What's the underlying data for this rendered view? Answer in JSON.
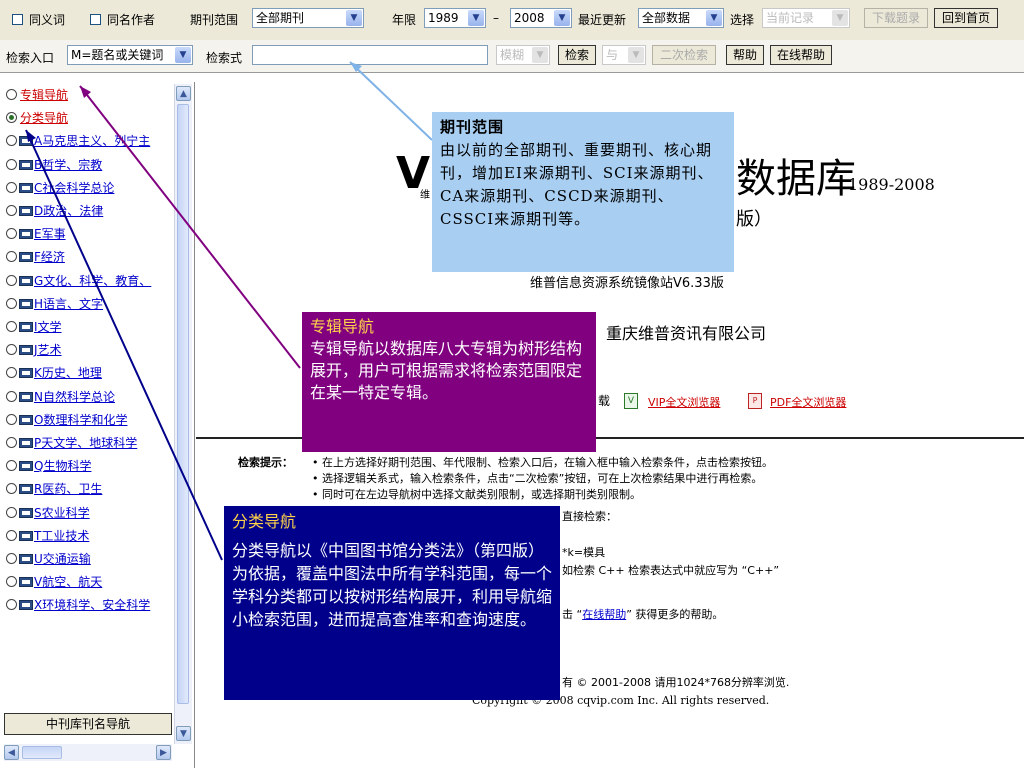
{
  "toolbar": {
    "synonym_label": "同义词",
    "same_author_label": "同名作者",
    "journal_range_label": "期刊范围",
    "journal_range_value": "全部期刊",
    "year_label": "年限",
    "year_from": "1989",
    "year_dash": "–",
    "year_to": "2008",
    "recent_update_label": "最近更新",
    "recent_update_value": "全部数据",
    "select_label": "选择",
    "select_value": "当前记录",
    "download_button": "下载题录",
    "home_button": "回到首页"
  },
  "search": {
    "entry_label": "检索入口",
    "entry_value": "M=题名或关键词",
    "expr_label": "检索式",
    "expr_value": "",
    "fuzzy_value": "模糊",
    "search_button": "检索",
    "logic_value": "与",
    "secondary_button": "二次检索",
    "help_button": "帮助",
    "online_help_button": "在线帮助"
  },
  "sidebar": {
    "top_items": [
      {
        "label": "专辑导航",
        "selected": false
      },
      {
        "label": "分类导航",
        "selected": true
      }
    ],
    "items": [
      "A马克思主义、列宁主",
      "B哲学、宗教",
      "C社会科学总论",
      "D政治、法律",
      "E军事",
      "F经济",
      "G文化、科学、教育、",
      "H语言、文字",
      "I文学",
      "J艺术",
      "K历史、地理",
      "N自然科学总论",
      "O数理科学和化学",
      "P天文学、地球科学",
      "Q生物科学",
      "R医药、卫生",
      "S农业科学",
      "T工业技术",
      "U交通运输",
      "V航空、航天",
      "X环境科学、安全科学"
    ],
    "bottom_button": "中刊库刊名导航"
  },
  "main": {
    "logo_left": "V",
    "logo_left_small": "维",
    "title_right": "数据库",
    "title_years": "1989-2008",
    "subtitle_paren": "版）",
    "mirror_text": "维普信息资源系统镜像站V6.33版",
    "company": "重庆维普资讯有限公司",
    "download_fragment": "载",
    "vip_browser": "VIP全文浏览器",
    "pdf_browser": "PDF全文浏览器",
    "tips_label": "检索提示：",
    "tips": [
      "• 在上方选择好期刊范围、年代限制、检索入口后，在输入框中输入检索条件，点击检索按钮。",
      "• 选择逻辑关系式，输入检索条件，点击“二次检索”按钮，可在上次检索结果中进行再检索。",
      "• 同时可在左边导航树中选择文献类别限制，或选择期刊类别限制。"
    ],
    "tip_frag_direct": "直接检索：",
    "tip_frag_mold": "*k=模具",
    "tip_frag_cpp": "如检索 C++ 检索表达式中就应写为 “C++”",
    "tip_frag_help_pre": "击 “",
    "tip_frag_help_link": "在线帮助",
    "tip_frag_help_post": "” 获得更多的帮助。",
    "copyright_frag": "有 © 2001-2008 请用1024*768分辨率浏览.",
    "copyright_line": "Copyright © 2008 cqvip.com Inc. All rights reserved."
  },
  "callouts": {
    "journal": {
      "title": "期刊范围",
      "body": "由以前的全部期刊、重要期刊、核心期刊，增加EI来源期刊、SCI来源期刊、CA来源期刊、CSCD来源期刊、CSSCI来源期刊等。"
    },
    "special": {
      "title": "专辑导航",
      "body": "专辑导航以数据库八大专辑为树形结构展开，用户可根据需求将检索范围限定在某一特定专辑。"
    },
    "category": {
      "title": "分类导航",
      "body": "分类导航以《中国图书馆分类法》（第四版）为依据，覆盖中图法中所有学科范围，每一个学科分类都可以按树形结构展开，利用导航缩小检索范围，进而提高查准率和查询速度。"
    }
  },
  "colors": {
    "callout_journal_bg": "#a8cef2",
    "callout_special_bg": "#800080",
    "callout_category_bg": "#00008b",
    "callout_title_accent": "#ffd24a",
    "link_blue": "#0000cc",
    "link_red": "#cc0000"
  }
}
